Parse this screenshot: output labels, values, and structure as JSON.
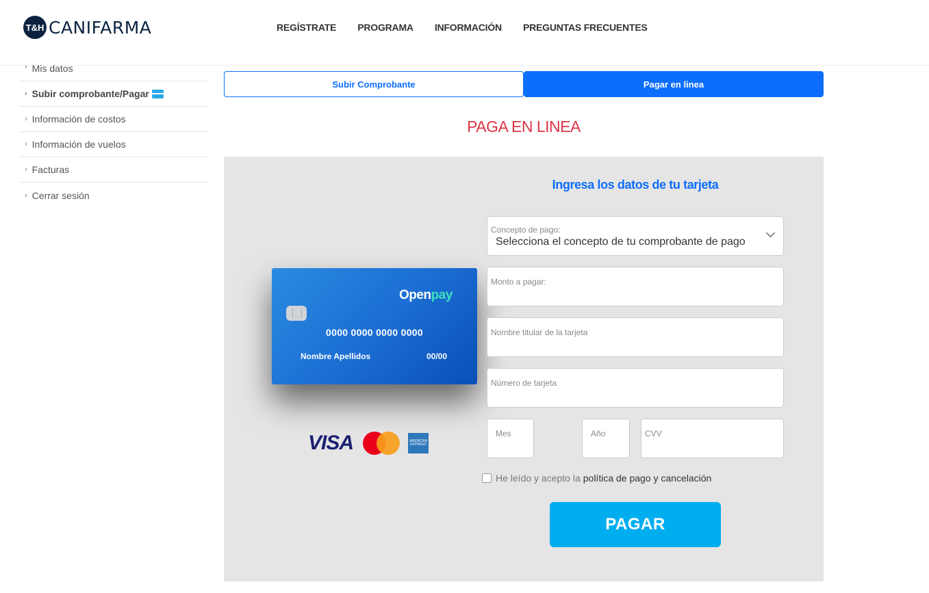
{
  "brand": {
    "mark": "T&H",
    "name": "CANIFARMA"
  },
  "nav": [
    "REGÍSTRATE",
    "PROGRAMA",
    "INFORMACIÓN",
    "PREGUNTAS FRECUENTES"
  ],
  "sidebar": {
    "items": [
      {
        "label": "Mis datos"
      },
      {
        "label": "Subir comprobante/Pagar"
      },
      {
        "label": "Información de costos"
      },
      {
        "label": "Información de vuelos"
      },
      {
        "label": "Facturas"
      },
      {
        "label": "Cerrar sesión"
      }
    ]
  },
  "tabs": {
    "upload": "Subir Comprobante",
    "online": "Pagar en linea"
  },
  "page_title": "PAGA EN LINEA",
  "card_preview": {
    "brand_a": "Open",
    "brand_b": "pay",
    "number": "0000 0000 0000 0000",
    "name": "Nombre Apellidos",
    "expiry": "00/00"
  },
  "brands": {
    "visa": "VISA",
    "amex": "AMERICAN EXPRESS"
  },
  "form": {
    "title": "Ingresa los datos de tu tarjeta",
    "concept_label": "Concepto de pago:",
    "concept_value": "Selecciona el concepto de tu comprobante de pago",
    "amount_label": "Monto a pagar:",
    "holder_label": "Nombre titular de la tarjeta",
    "number_label": "Número de tarjeta",
    "month_label": "Mes",
    "year_label": "Año",
    "cvv_label": "CVV",
    "terms_text": "He leído y acepto la",
    "terms_link": "política de pago y cancelación",
    "pay_button": "PAGAR"
  }
}
